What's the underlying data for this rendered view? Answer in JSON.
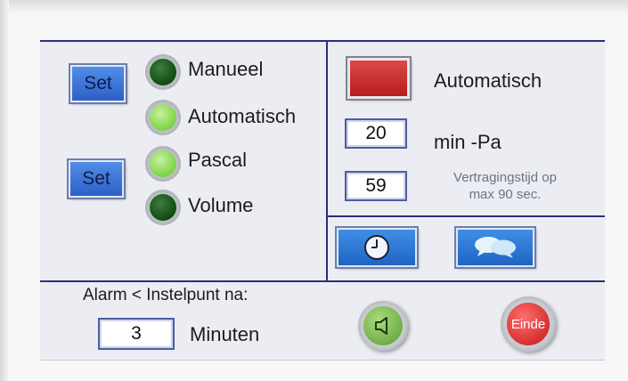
{
  "mode_panel": {
    "set_button_1": "Set",
    "set_button_2": "Set",
    "modes": [
      {
        "label": "Manueel",
        "state": "off"
      },
      {
        "label": "Automatisch",
        "state": "on"
      },
      {
        "label": "Pascal",
        "state": "on"
      },
      {
        "label": "Volume",
        "state": "off"
      }
    ]
  },
  "auto_panel": {
    "status_label": "Automatisch",
    "min_value": "20",
    "min_unit": "min -Pa",
    "delay_value": "59",
    "delay_label_line1": "Vertragingstijd op",
    "delay_label_line2": "max 90 sec."
  },
  "icons": {
    "clock": "clock-icon",
    "chat": "chat-bubbles-icon",
    "speaker": "speaker-icon"
  },
  "alarm": {
    "title": "Alarm < Instelpunt na:",
    "minutes_value": "3",
    "minutes_label": "Minuten"
  },
  "stop_button": "Einde",
  "colors": {
    "divider": "#2a2f7a",
    "led_on": "#7ad446",
    "led_off": "#0f4d10",
    "status_red": "#c62828",
    "button_blue": "#2e5fc8"
  }
}
